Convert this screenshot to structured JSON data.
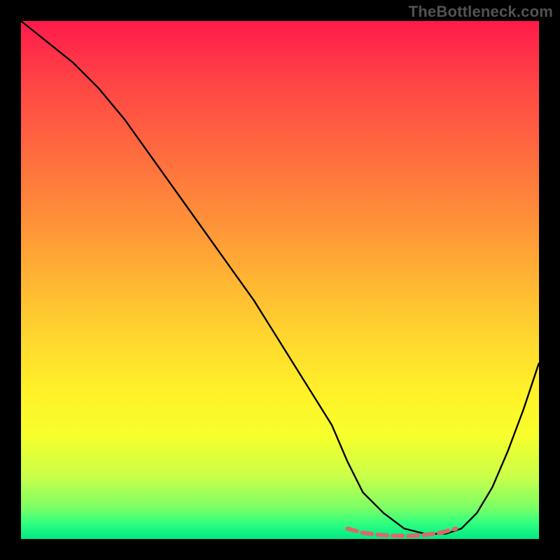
{
  "watermark": "TheBottleneck.com",
  "chart_data": {
    "type": "line",
    "title": "",
    "xlabel": "",
    "ylabel": "",
    "xlim": [
      0,
      100
    ],
    "ylim": [
      0,
      100
    ],
    "grid": false,
    "legend": false,
    "series": [
      {
        "name": "bottleneck-curve",
        "color": "#000000",
        "x": [
          0,
          5,
          10,
          15,
          20,
          25,
          30,
          35,
          40,
          45,
          50,
          55,
          60,
          63,
          66,
          70,
          74,
          78,
          82,
          85,
          88,
          91,
          94,
          97,
          100
        ],
        "values": [
          100,
          96,
          92,
          87,
          81,
          74,
          67,
          60,
          53,
          46,
          38,
          30,
          22,
          15,
          9,
          5,
          2,
          1,
          1,
          2,
          5,
          10,
          17,
          25,
          34
        ]
      },
      {
        "name": "optimal-range-marker",
        "color": "#e06666",
        "x": [
          63,
          66,
          69,
          72,
          75,
          78,
          81,
          84
        ],
        "values": [
          2,
          1.2,
          0.8,
          0.6,
          0.6,
          0.8,
          1.2,
          2
        ]
      }
    ],
    "background_gradient": {
      "top": "#ff1a4b",
      "mid": "#ffd92e",
      "bottom": "#00e884"
    }
  }
}
